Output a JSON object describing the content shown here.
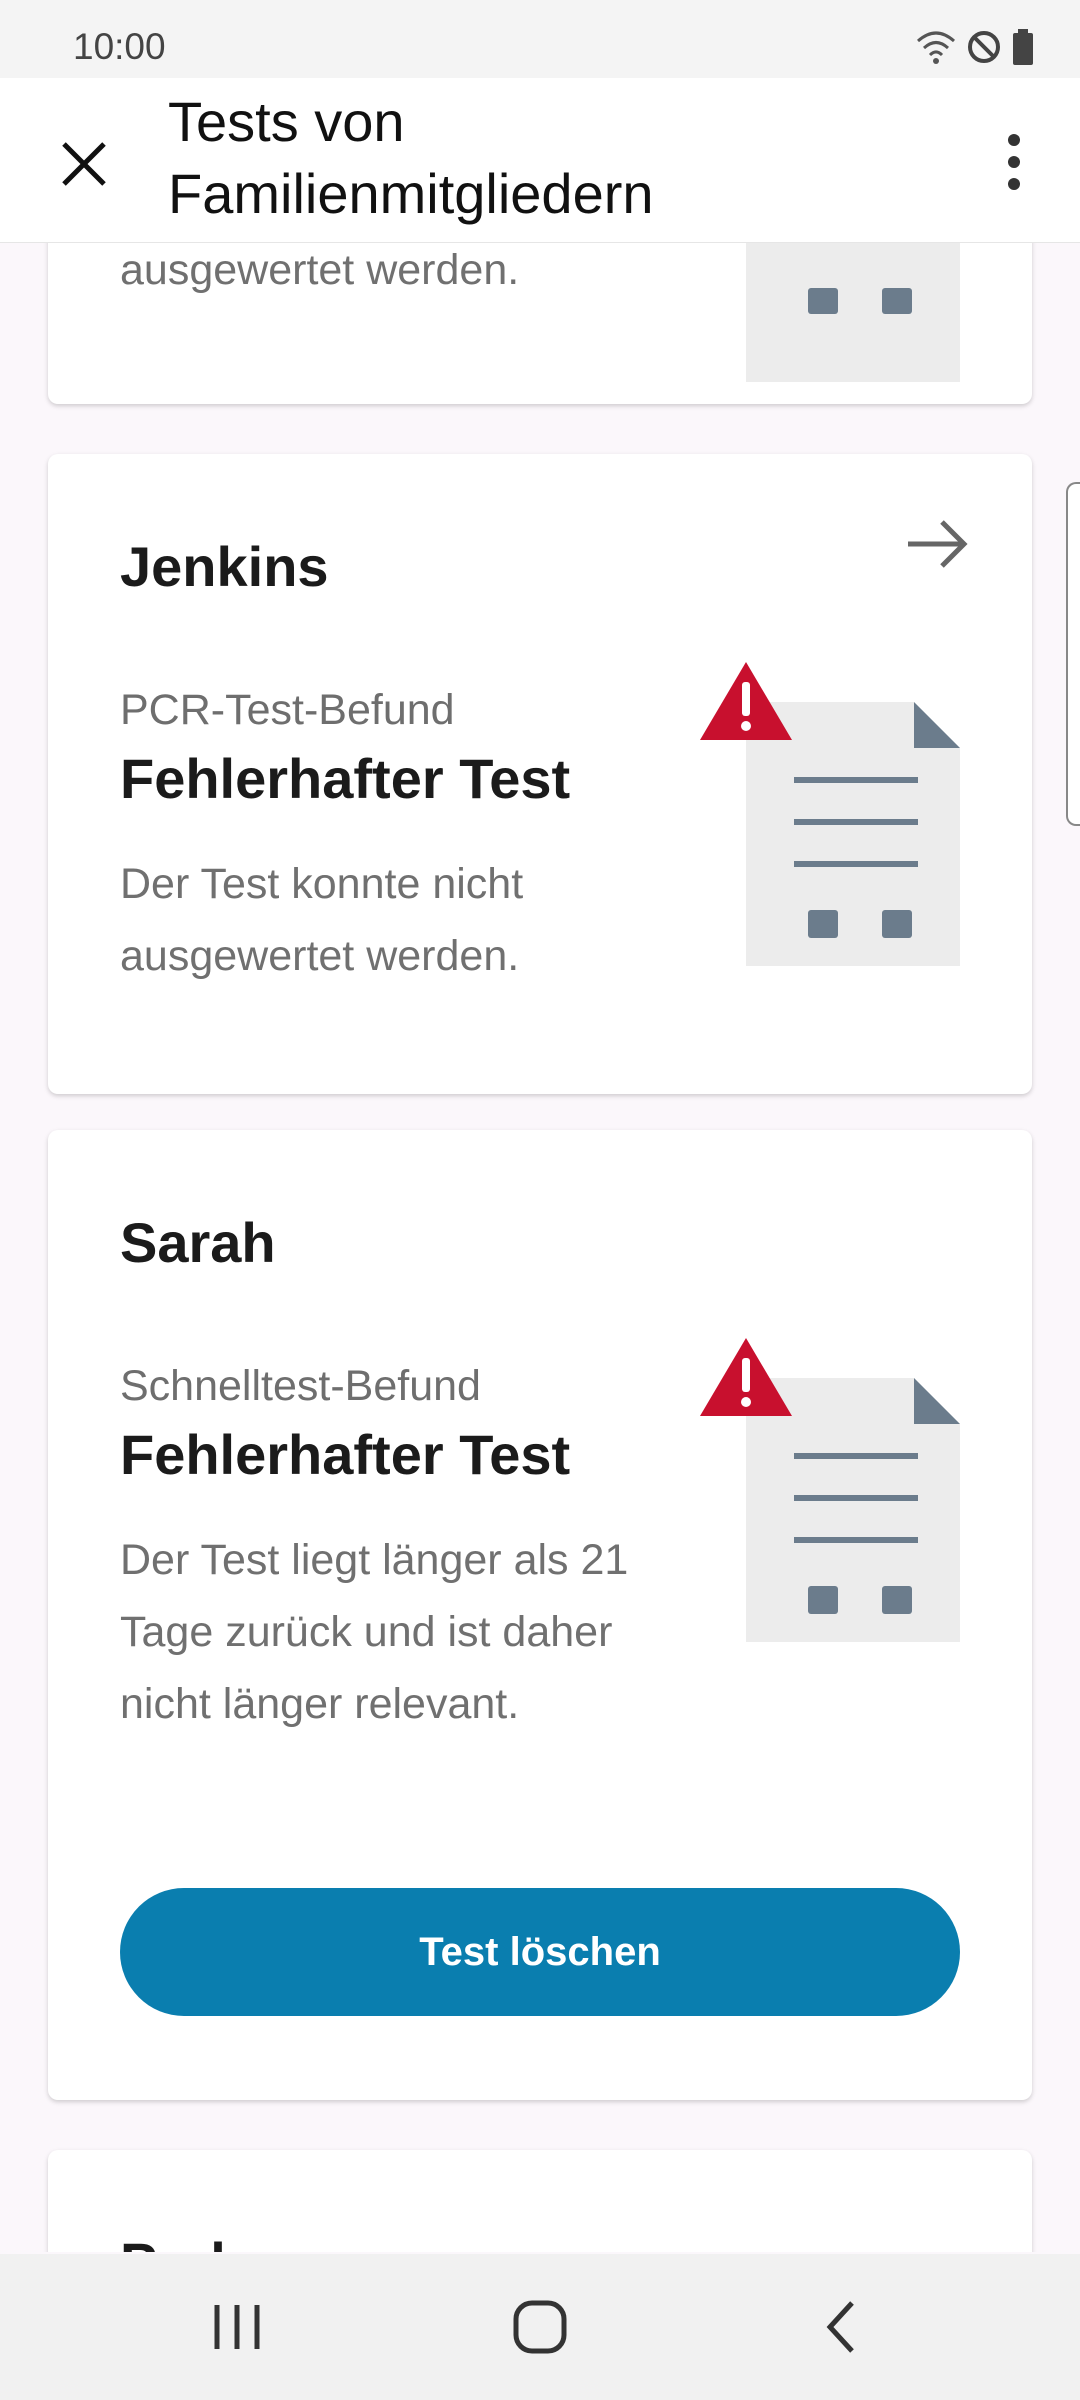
{
  "status_bar": {
    "time": "10:00",
    "icons": [
      "wifi-icon",
      "do-not-disturb-icon",
      "battery-icon"
    ]
  },
  "toolbar": {
    "title": "Tests von Familienmitgliedern",
    "close_icon": "close-icon",
    "more_icon": "more-vert-icon"
  },
  "cards": [
    {
      "name": "",
      "desc_last_line": "ausgewertet werden."
    },
    {
      "name": "Jenkins",
      "test_type": "PCR-Test-Befund",
      "status": "Fehlerhafter Test",
      "description": "Der Test konnte nicht ausgewertet werden.",
      "arrow_icon": "arrow-right-icon"
    },
    {
      "name": "Sarah",
      "test_type": "Schnelltest-Befund",
      "status": "Fehlerhafter Test",
      "description": "Der Test liegt länger als 21 Tage zurück und ist daher nicht länger relevant.",
      "button": "Test löschen"
    },
    {
      "name": "Parker"
    }
  ],
  "colors": {
    "accent": "#0a7eaf",
    "warning": "#c8102e",
    "doc_gray": "#ececec",
    "doc_icon": "#6b7c8c"
  },
  "nav_bar": {
    "items": [
      "recent-apps-icon",
      "home-icon",
      "back-icon"
    ]
  }
}
